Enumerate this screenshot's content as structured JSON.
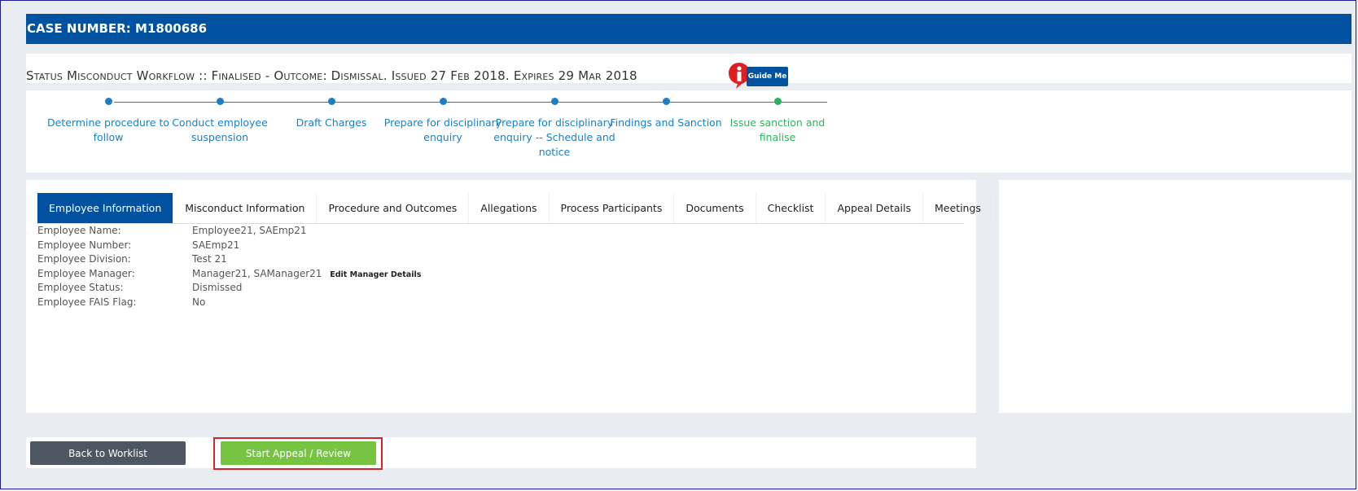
{
  "case": {
    "label": "CASE NUMBER:",
    "number": "M1800686"
  },
  "status": {
    "text": "Status Misconduct Workflow :: Finalised - Outcome: Dismissal. Issued 27 Feb 2018. Expires 29 Mar 2018",
    "guide_label": "Guide Me"
  },
  "steps": [
    {
      "label": "Determine procedure to follow",
      "state": "complete"
    },
    {
      "label": "Conduct employee suspension",
      "state": "complete"
    },
    {
      "label": "Draft Charges",
      "state": "complete"
    },
    {
      "label": "Prepare for disciplinary enquiry",
      "state": "complete"
    },
    {
      "label": "Prepare for disciplinary enquiry -- Schedule and notice",
      "state": "complete"
    },
    {
      "label": "Findings and Sanction",
      "state": "complete"
    },
    {
      "label": "Issue sanction and finalise",
      "state": "current"
    }
  ],
  "tabs": [
    {
      "label": "Employee Information",
      "active": true
    },
    {
      "label": "Misconduct Information"
    },
    {
      "label": "Procedure and Outcomes"
    },
    {
      "label": "Allegations"
    },
    {
      "label": "Process Participants"
    },
    {
      "label": "Documents"
    },
    {
      "label": "Checklist"
    },
    {
      "label": "Appeal Details"
    },
    {
      "label": "Meetings"
    }
  ],
  "employee": {
    "name_label": "Employee Name:",
    "name": "Employee21, SAEmp21",
    "number_label": "Employee Number:",
    "number": "SAEmp21",
    "division_label": "Employee Division:",
    "division": "Test 21",
    "manager_label": "Employee Manager:",
    "manager": "Manager21, SAManager21",
    "edit_manager_label": "Edit Manager Details",
    "status_label": "Employee Status:",
    "status": "Dismissed",
    "fais_label": "Employee FAIS Flag:",
    "fais": "No"
  },
  "actions": {
    "back_label": "Back to Worklist",
    "appeal_label": "Start Appeal / Review"
  },
  "colors": {
    "brand_blue": "#0052a0",
    "step_blue": "#1a7fc4",
    "step_current_green": "#2db35d",
    "appeal_green": "#76c442",
    "highlight_red": "#d8232a"
  }
}
